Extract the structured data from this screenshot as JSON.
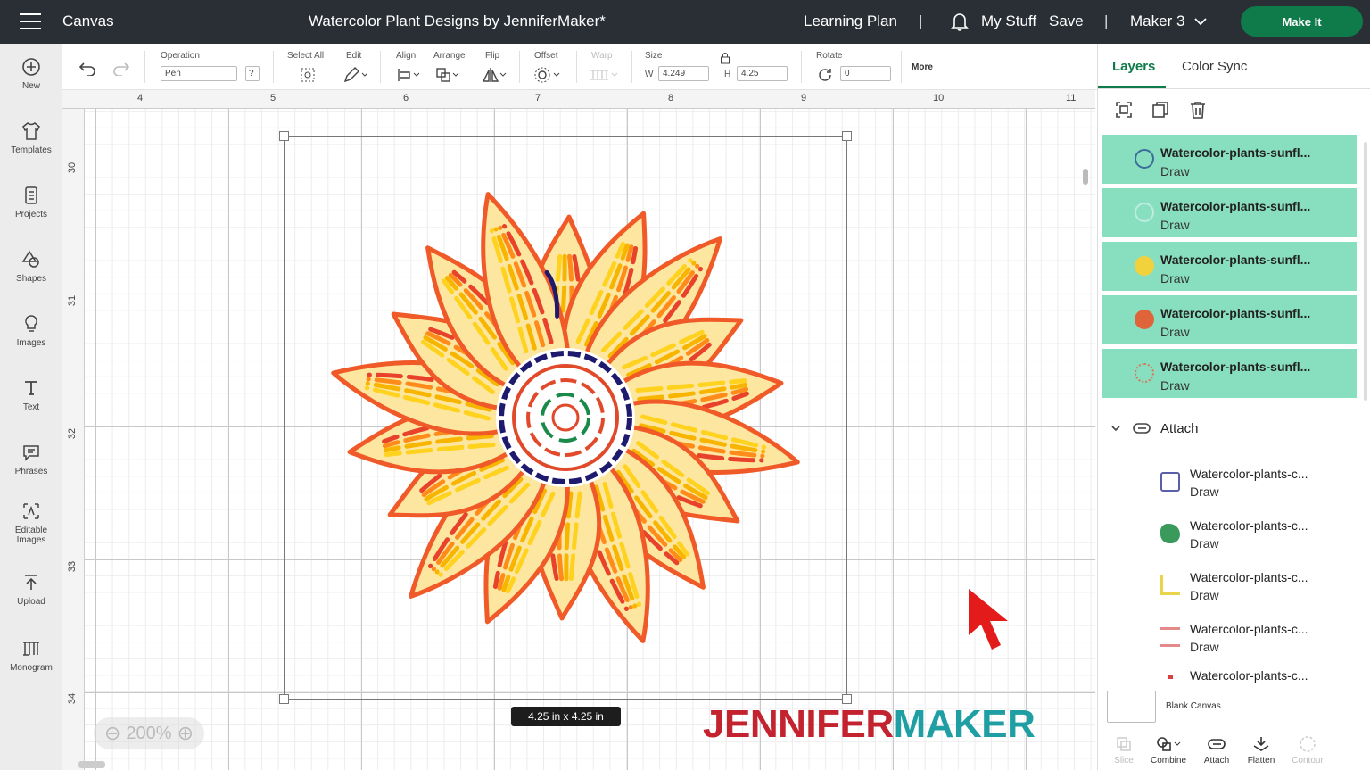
{
  "header": {
    "app_label": "Canvas",
    "project_title": "Watercolor Plant Designs by JenniferMaker*",
    "learning_plan": "Learning Plan",
    "separator": "|",
    "my_stuff": "My Stuff",
    "save": "Save",
    "machine": "Maker 3",
    "make_it": "Make It"
  },
  "leftnav": [
    {
      "label": "New",
      "icon": "plus-circle-icon"
    },
    {
      "label": "Templates",
      "icon": "shirt-icon"
    },
    {
      "label": "Projects",
      "icon": "projects-icon"
    },
    {
      "label": "Shapes",
      "icon": "shapes-icon"
    },
    {
      "label": "Images",
      "icon": "lightbulb-icon"
    },
    {
      "label": "Text",
      "icon": "text-icon"
    },
    {
      "label": "Phrases",
      "icon": "speech-bubble-icon"
    },
    {
      "label": "Editable",
      "label2": "Images",
      "icon": "editable-images-icon"
    },
    {
      "label": "Upload",
      "icon": "upload-icon"
    },
    {
      "label": "Monogram",
      "icon": "monogram-icon"
    }
  ],
  "toolbar": {
    "operation_label": "Operation",
    "operation_value": "Pen",
    "help": "?",
    "select_all": "Select All",
    "edit": "Edit",
    "align": "Align",
    "arrange": "Arrange",
    "flip": "Flip",
    "offset": "Offset",
    "warp": "Warp",
    "size": "Size",
    "w_label": "W",
    "w_value": "4.249",
    "h_label": "H",
    "h_value": "4.25",
    "rotate": "Rotate",
    "rotate_value": "0",
    "more": "More"
  },
  "ruler": {
    "h": [
      "4",
      "5",
      "6",
      "7",
      "8",
      "9",
      "10",
      "11"
    ],
    "v": [
      "30",
      "31",
      "32",
      "33",
      "34"
    ]
  },
  "canvas": {
    "size_tag": "4.25  in x 4.25  in",
    "zoom": "200%",
    "brand_a": "JENNIFER",
    "brand_b": "MAKER"
  },
  "panel": {
    "tab_layers": "Layers",
    "tab_color_sync": "Color Sync",
    "layers": [
      {
        "name": "Watercolor-plants-sunfl...",
        "type": "Draw",
        "color": "#3b6f9a"
      },
      {
        "name": "Watercolor-plants-sunfl...",
        "type": "Draw",
        "color": "#bdece0"
      },
      {
        "name": "Watercolor-plants-sunfl...",
        "type": "Draw",
        "color": "#f1d23c"
      },
      {
        "name": "Watercolor-plants-sunfl...",
        "type": "Draw",
        "color": "#e0643a"
      },
      {
        "name": "Watercolor-plants-sunfl...",
        "type": "Draw",
        "color": "#d9755a"
      }
    ],
    "group_label": "Attach",
    "children": [
      {
        "name": "Watercolor-plants-c...",
        "type": "Draw",
        "color": "#5b5fa8"
      },
      {
        "name": "Watercolor-plants-c...",
        "type": "Draw",
        "color": "#3a9a5b"
      },
      {
        "name": "Watercolor-plants-c...",
        "type": "Draw",
        "color": "#e8d54a"
      },
      {
        "name": "Watercolor-plants-c...",
        "type": "Draw",
        "color": "#e58a8a"
      },
      {
        "name": "Watercolor-plants-c...",
        "type": "",
        "color": "#d94040"
      }
    ],
    "blank_canvas": "Blank Canvas",
    "actions": [
      "Slice",
      "Combine",
      "Attach",
      "Flatten",
      "Contour"
    ]
  }
}
